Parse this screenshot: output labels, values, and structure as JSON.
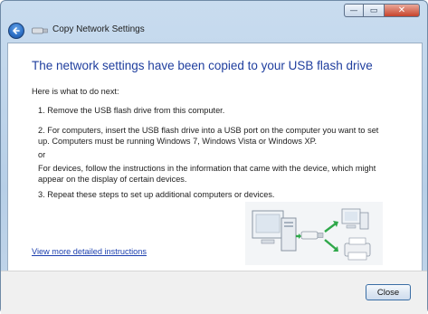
{
  "window": {
    "title": "Copy Network Settings",
    "caption_buttons": [
      "minimize",
      "maximize",
      "close"
    ]
  },
  "main": {
    "heading": "The network settings have been copied to your USB flash drive",
    "intro": "Here is what to do next:",
    "step1": "1. Remove the USB flash drive from this computer.",
    "step2_line1": "2. For computers, insert the USB flash drive into a USB port on the computer you want to set",
    "step2_line2": "up. Computers must be running Windows 7, Windows Vista or Windows XP.",
    "or": "or",
    "devices_line1": "For devices, follow the instructions in the information that came with the device, which might",
    "devices_line2": "appear on the display of certain devices.",
    "step3": "3. Repeat these steps to set up additional computers or devices.",
    "link": "View more detailed instructions"
  },
  "footer": {
    "close_label": "Close"
  },
  "icons": {
    "back": "back-arrow-icon",
    "usb": "usb-drive-icon",
    "illustration": "copy-settings-illustration"
  }
}
